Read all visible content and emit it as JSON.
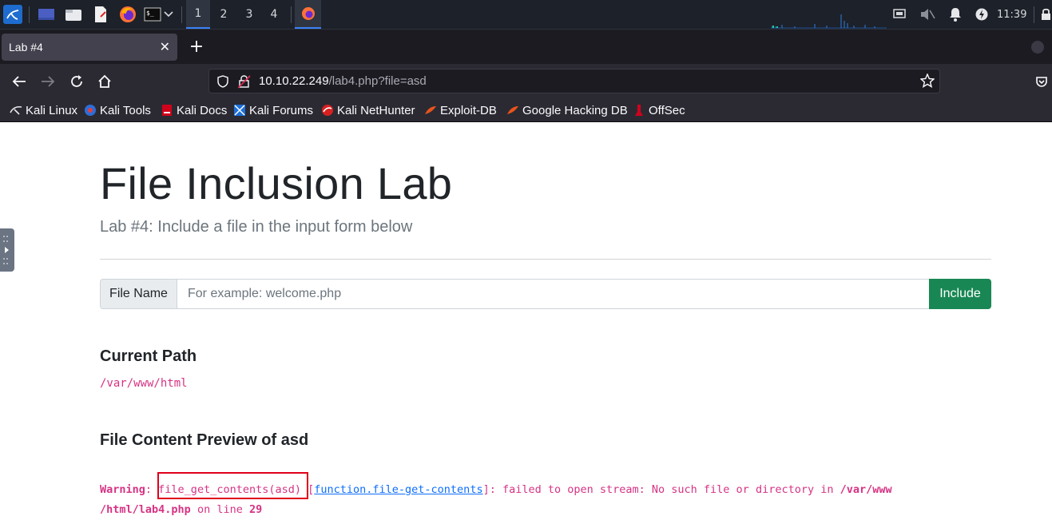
{
  "taskbar": {
    "workspaces": [
      "1",
      "2",
      "3",
      "4"
    ],
    "clock": "11:39",
    "icons": [
      "kali-menu-icon",
      "desktop-icon",
      "file-manager-icon",
      "text-editor-icon",
      "firefox-icon",
      "terminal-icon"
    ]
  },
  "browser": {
    "tab_title": "Lab #4",
    "url_host": "10.10.22.249",
    "url_path": "/lab4.php?file=asd",
    "bookmarks": [
      "Kali Linux",
      "Kali Tools",
      "Kali Docs",
      "Kali Forums",
      "Kali NetHunter",
      "Exploit-DB",
      "Google Hacking DB",
      "OffSec"
    ]
  },
  "page": {
    "title": "File Inclusion Lab",
    "lead": "Lab #4: Include a file in the input form below",
    "form": {
      "label": "File Name",
      "placeholder": "For example: welcome.php",
      "button": "Include"
    },
    "current_path_heading": "Current Path",
    "current_path": "/var/www/html",
    "preview_heading": "File Content Preview of",
    "preview_file": "asd",
    "warning": {
      "label": "Warning",
      "func": "file_get_contents(asd)",
      "link": "function.file-get-contents",
      "message": "]: failed to open stream: No such file or directory in",
      "path1": "/var/www",
      "path2": "/html/lab4.php",
      "on_line": "on line",
      "line": "29"
    }
  },
  "colors": {
    "accent": "#198754",
    "code": "#d63384",
    "link": "#0d6efd",
    "highlight": "#e0001a"
  }
}
